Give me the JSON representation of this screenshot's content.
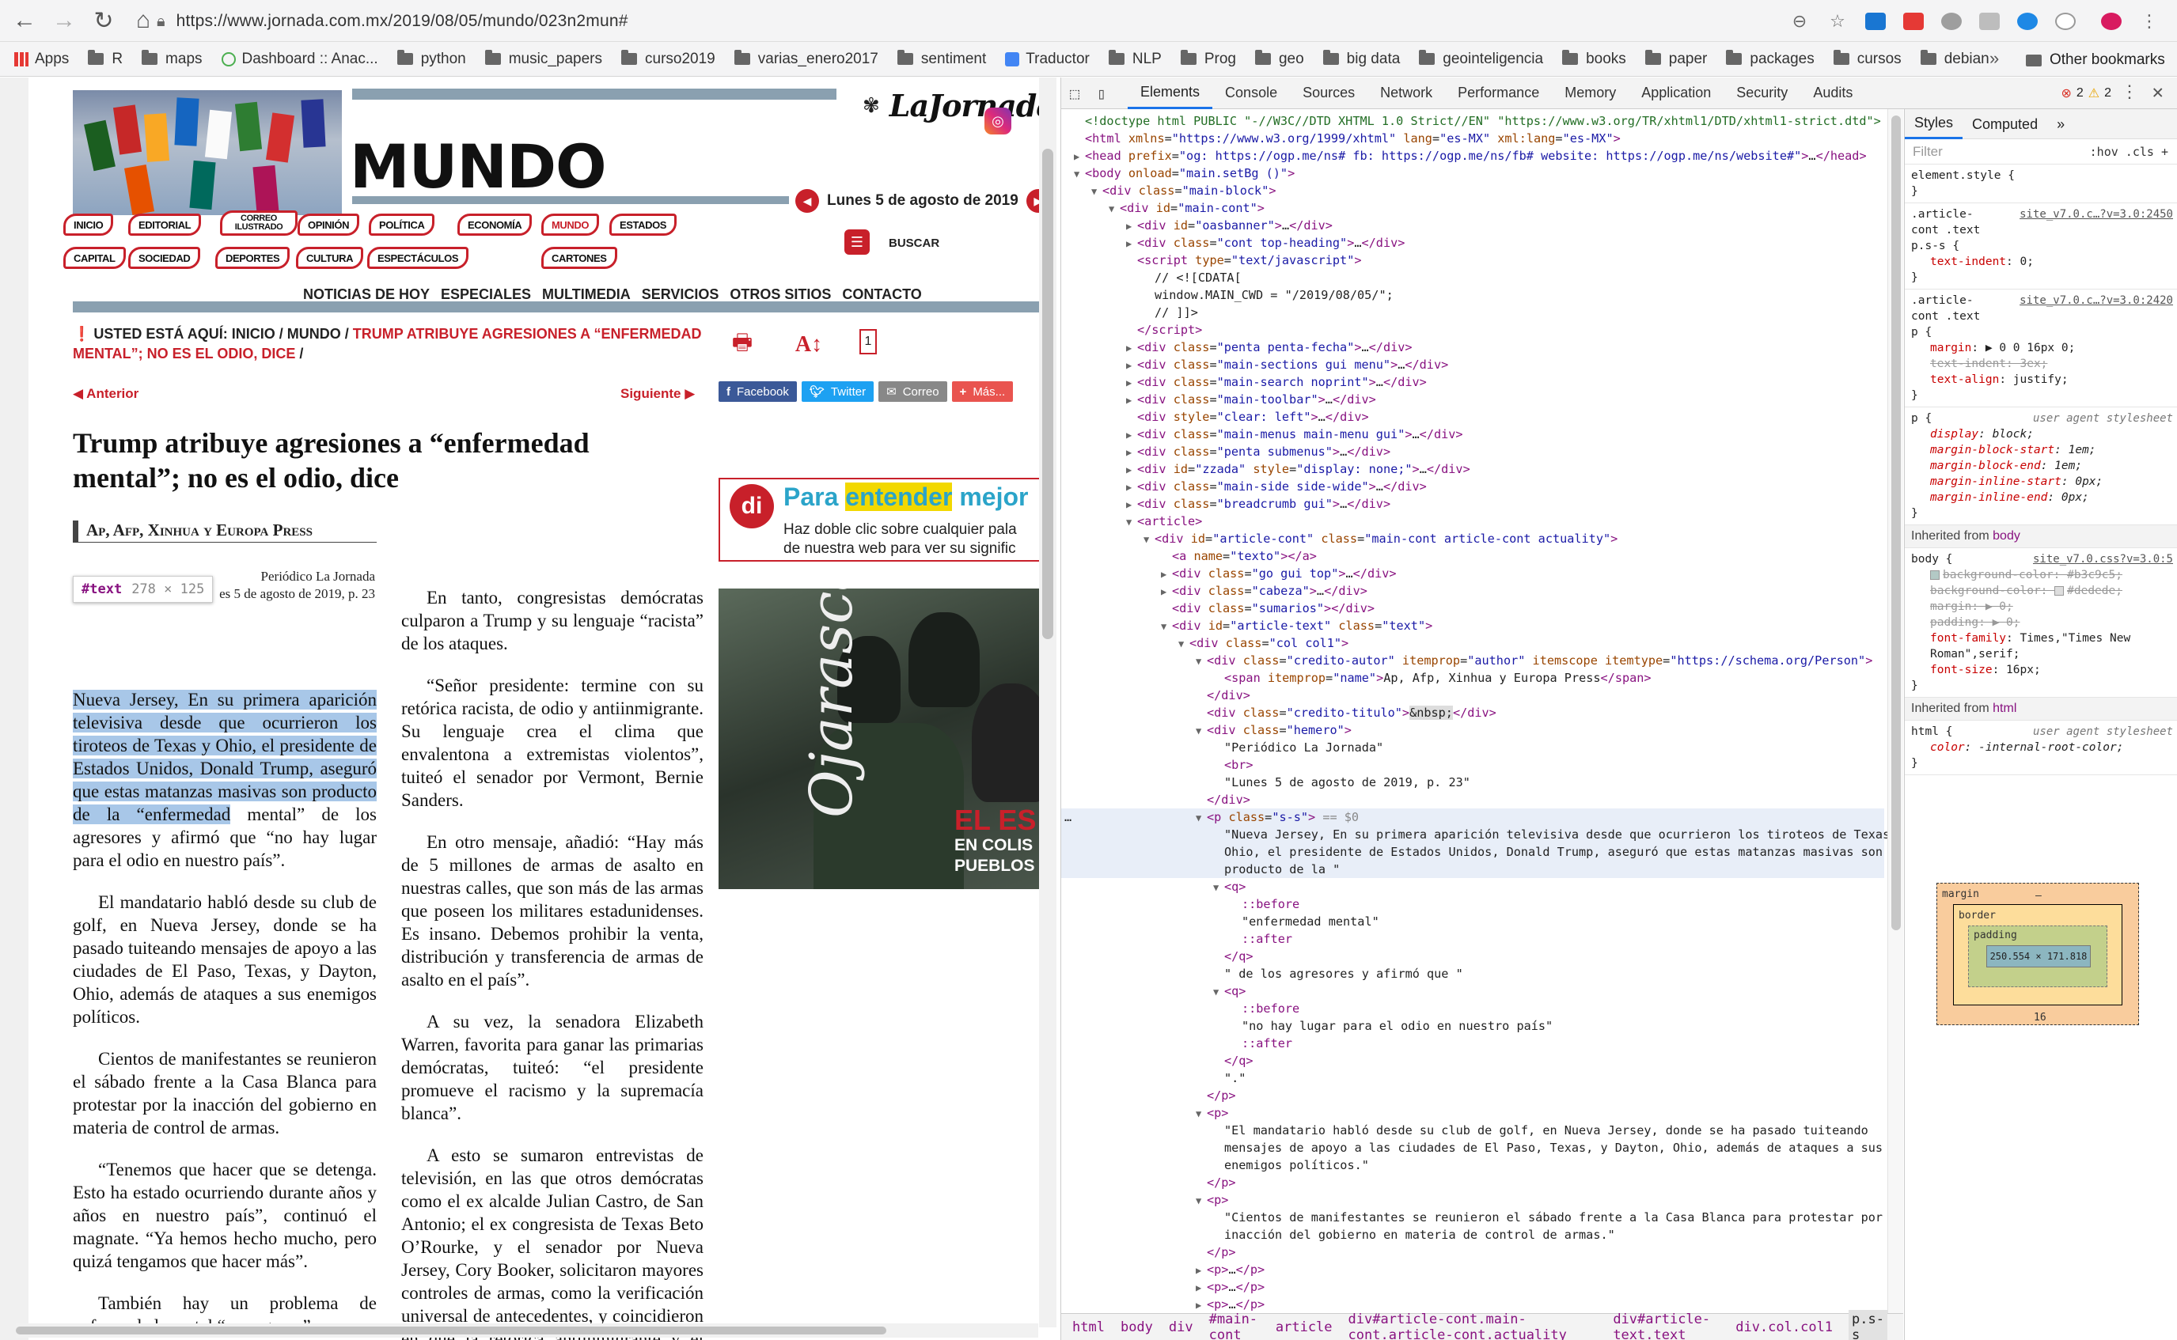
{
  "browser": {
    "url": "https://www.jornada.com.mx/2019/08/05/mundo/023n2mun#",
    "bookmarks": [
      "Apps",
      "R",
      "maps",
      "Dashboard :: Anac...",
      "python",
      "music_papers",
      "curso2019",
      "varias_enero2017",
      "sentiment",
      "Traductor",
      "NLP",
      "Prog",
      "geo",
      "big data",
      "geointeligencia",
      "books",
      "paper",
      "packages",
      "cursos",
      "debian"
    ],
    "more": "»",
    "other_bookmarks": "Other bookmarks"
  },
  "site": {
    "section_title": "MUNDO",
    "logo": "LaJornada",
    "date": "Lunes 5 de agosto de 2019",
    "sections_row1": [
      "INICIO",
      "EDITORIAL",
      "CORREO ILUSTRADO",
      "OPINIÓN",
      "POLÍTICA",
      "ECONOMÍA",
      "MUNDO",
      "ESTADOS"
    ],
    "sections_row2": [
      "CAPITAL",
      "SOCIEDAD",
      "DEPORTES",
      "CULTURA",
      "ESPECTÁCULOS",
      "CARTONES"
    ],
    "buscar": "BUSCAR",
    "topnav": [
      "NOTICIAS DE HOY",
      "ESPECIALES",
      "MULTIMEDIA",
      "SERVICIOS",
      "OTROS SITIOS",
      "CONTACTO"
    ],
    "breadcrumb_prefix": "USTED ESTÁ AQUÍ: INICIO / MUNDO / ",
    "breadcrumb_current": "TRUMP ATRIBUYE AGRESIONES A “ENFERMEDAD MENTAL”; NO ES EL ODIO, DICE",
    "breadcrumb_suffix": " /",
    "prev": "◀ Anterior",
    "next": "Siguiente ▶",
    "font_size_badge": "1",
    "share": [
      "Facebook",
      "Twitter",
      "Correo",
      "Más..."
    ]
  },
  "article": {
    "title": "Trump atribuye agresiones a “enfermedad mental”; no es el odio, dice",
    "author": "Ap, Afp, Xinhua y Europa Press",
    "hemero1": "Periódico La Jornada",
    "hemero2": "es 5 de agosto de 2019, p. 23",
    "tooltip_node": "#text",
    "tooltip_dim": "278 × 125",
    "p1_highlight": "Nueva Jersey, En su primera aparición televisiva desde que ocurrieron los tiroteos de Texas y Ohio, el presidente de Estados Unidos, Donald Trump, aseguró que estas matanzas masivas son producto de la “enfermedad",
    "p1_rest": " mental” de los agresores y afirmó que “no hay lugar para el odio en nuestro país”.",
    "col1": [
      "El mandatario habló desde su club de golf, en Nueva Jersey, donde se ha pasado tuiteando mensajes de apoyo a las ciudades de El Paso, Texas, y Dayton, Ohio, además de ataques a sus enemigos políticos.",
      "Cientos de manifestantes se reunieron el sábado frente a la Casa Blanca para protestar por la inacción del gobierno en materia de control de armas.",
      "“Tenemos que hacer que se detenga. Esto ha estado ocurriendo durante años y años en nuestro país”, continuó el magnate. “Ya hemos hecho mucho, pero quizá tengamos que hacer más”.",
      "También hay un problema de enfermedad mental “muy grave” en"
    ],
    "col2": [
      "En tanto, congresistas demócratas culparon a Trump y su lenguaje “racista” de los ataques.",
      "“Señor presidente: termine con su retórica racista, de odio y antiinmigrante. Su lenguaje crea el clima que envalentona a extremistas violentos”, tuiteó el senador por Vermont, Bernie Sanders.",
      "En otro mensaje, añadió: “Hay más de 5 millones de armas de asalto en nuestras calles, que son más de las armas que poseen los militares estadunidenses. Es insano. Debemos prohibir la venta, distribución y transferencia de armas de asalto en el país”.",
      "A su vez, la senadora Elizabeth Warren, favorita para ganar las primarias demócratas, tuiteó: “el presidente promueve el racismo y la supremacía blanca”.",
      "A esto se sumaron entrevistas de televisión, en las que otros demócratas como el ex alcalde Julian Castro, de San Antonio; el ex congresista de Texas Beto O’Rourke, y el senador por Nueva Jersey, Cory Booker, solicitaron mayores controles de armas, como la verificación universal de antecedentes, y coincidieron en que la retórica antiinmigrante y el lenguaje"
    ]
  },
  "ads": {
    "ad1_di": "di",
    "ad1_t1a": "Para ",
    "ad1_t1b": "entender",
    "ad1_t1c": " mejor",
    "ad1_t2a": "Haz doble clic sobre cualquier pala",
    "ad1_t2b": "de nuestra web para ver su signific",
    "ad2_v": "Ojarasca",
    "ad2_els": "EL ES",
    "ad2_en1": "EN COLIS",
    "ad2_en2": "PUEBLOS"
  },
  "devtools": {
    "tabs": [
      "Elements",
      "Console",
      "Sources",
      "Network",
      "Performance",
      "Memory",
      "Application",
      "Security",
      "Audits"
    ],
    "errors": "2",
    "warnings": "2",
    "crumbs": [
      "html",
      "body",
      "div",
      "#main-cont",
      "article",
      "div#article-cont.main-cont.article-cont.actuality",
      "div#article-text.text",
      "div.col.col1",
      "p.s-s"
    ],
    "style_tabs": [
      "Styles",
      "Computed",
      "»"
    ],
    "filter_placeholder": "Filter",
    "filter_right": ":hov .cls +",
    "box_margin": "margin",
    "box_margin_dash": "–",
    "box_border": "border",
    "box_padding": "padding",
    "box_content": "250.554 × 171.818",
    "box_bottom": "16"
  }
}
